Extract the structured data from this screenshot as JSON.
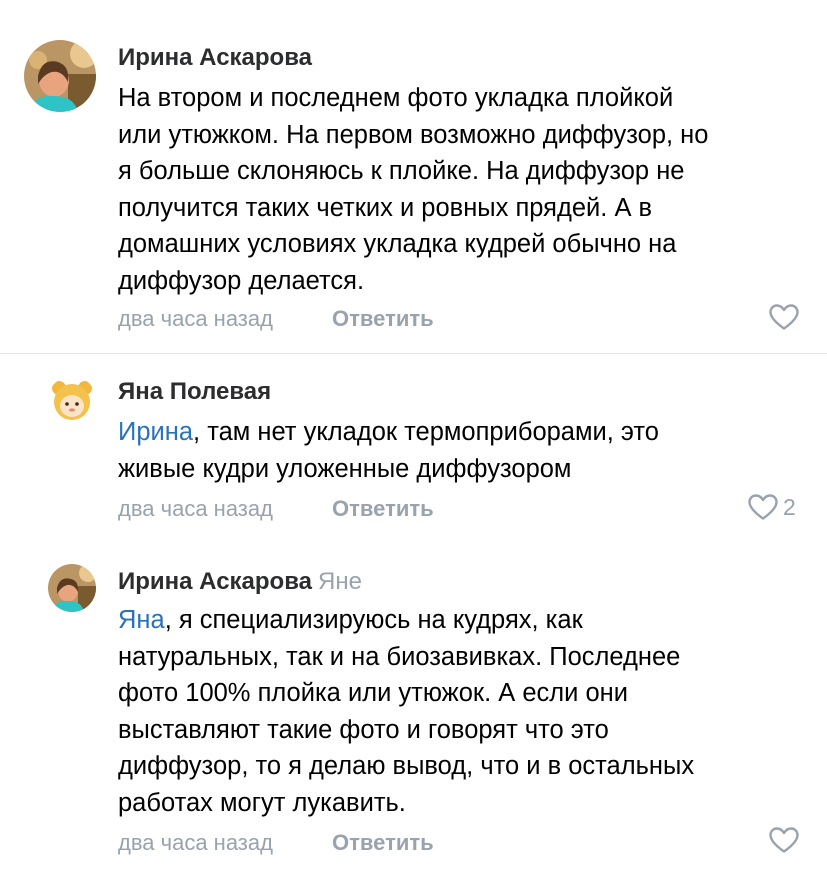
{
  "comments": [
    {
      "author": "Ирина Аскарова",
      "reply_to": "",
      "mention": "",
      "text_lines": [
        "На втором и последнем фото укладка плойкой",
        "или утюжком. На первом возможно диффузор, но",
        "я больше склоняюсь к плойке. На диффузор не",
        "получится таких четких и ровных прядей. А в",
        "домашних условиях укладка кудрей обычно на",
        "диффузор делается."
      ],
      "time": "два часа назад",
      "reply_label": "Ответить",
      "likes": ""
    },
    {
      "author": "Яна Полевая",
      "reply_to": "",
      "mention": "Ирина",
      "text_lines": [
        ", там нет укладок термоприборами, это",
        "живые кудри уложенные диффузором"
      ],
      "time": "два часа назад",
      "reply_label": "Ответить",
      "likes": "2"
    },
    {
      "author": "Ирина Аскарова",
      "reply_to": "Яне",
      "mention": "Яна",
      "text_lines": [
        ", я специализируюсь на кудрях, как",
        "натуральных, так и на биозавивках. Последнее",
        "фото 100% плойка или утюжок. А если они",
        "выставляют такие фото и говорят что это",
        "диффузор, то я делаю вывод, что и в остальных",
        "работах могут лукавить."
      ],
      "time": "два часа назад",
      "reply_label": "Ответить",
      "likes": ""
    }
  ],
  "colors": {
    "mention": "#2a73b9",
    "secondary": "#99a2ad",
    "text": "#000000"
  },
  "icons": {
    "like": "heart-outline-icon"
  }
}
